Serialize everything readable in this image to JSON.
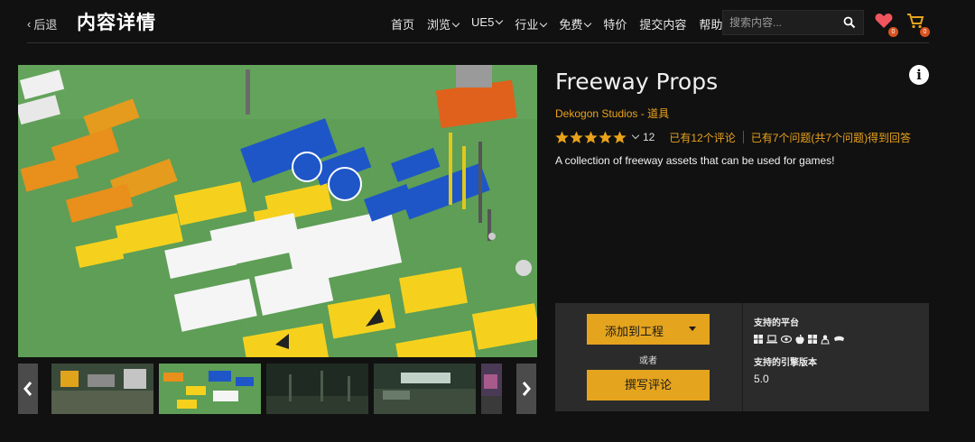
{
  "header": {
    "back_label": "后退",
    "page_title": "内容详情",
    "nav": [
      {
        "label": "首页",
        "has_dropdown": false
      },
      {
        "label": "浏览",
        "has_dropdown": true
      },
      {
        "label": "UE5",
        "has_dropdown": true
      },
      {
        "label": "行业",
        "has_dropdown": true
      },
      {
        "label": "免费",
        "has_dropdown": true
      },
      {
        "label": "特价",
        "has_dropdown": false
      },
      {
        "label": "提交内容",
        "has_dropdown": false
      },
      {
        "label": "帮助",
        "has_dropdown": false
      }
    ],
    "search_placeholder": "搜索内容...",
    "wishlist_count": "0",
    "cart_count": "0"
  },
  "product": {
    "title": "Freeway Props",
    "publisher": "Dekogon Studios",
    "separator": " - ",
    "category": "道具",
    "rating_stars": 5,
    "rating_count": "12",
    "reviews_link": "已有12个评论",
    "questions_link": "已有7个问题(共7个问题)得到回答",
    "description": "A collection of freeway assets that can be used for games!"
  },
  "gallery": {
    "thumbnail_count": 5,
    "selected_index": 1
  },
  "actions": {
    "add_to_project": "添加到工程",
    "or": "或者",
    "write_review": "撰写评论"
  },
  "specs": {
    "platforms_heading": "支持的平台",
    "platform_icons": [
      "windows-icon",
      "laptop-icon",
      "eye-icon",
      "apple-icon",
      "windows-icon",
      "linux-icon",
      "hololens-icon"
    ],
    "engine_heading": "支持的引擎版本",
    "engine_version": "5.0"
  },
  "colors": {
    "accent": "#e5a41d",
    "link": "#e9a21b",
    "background": "#111111",
    "panel": "#2b2b2b",
    "badge": "#d9531e"
  }
}
